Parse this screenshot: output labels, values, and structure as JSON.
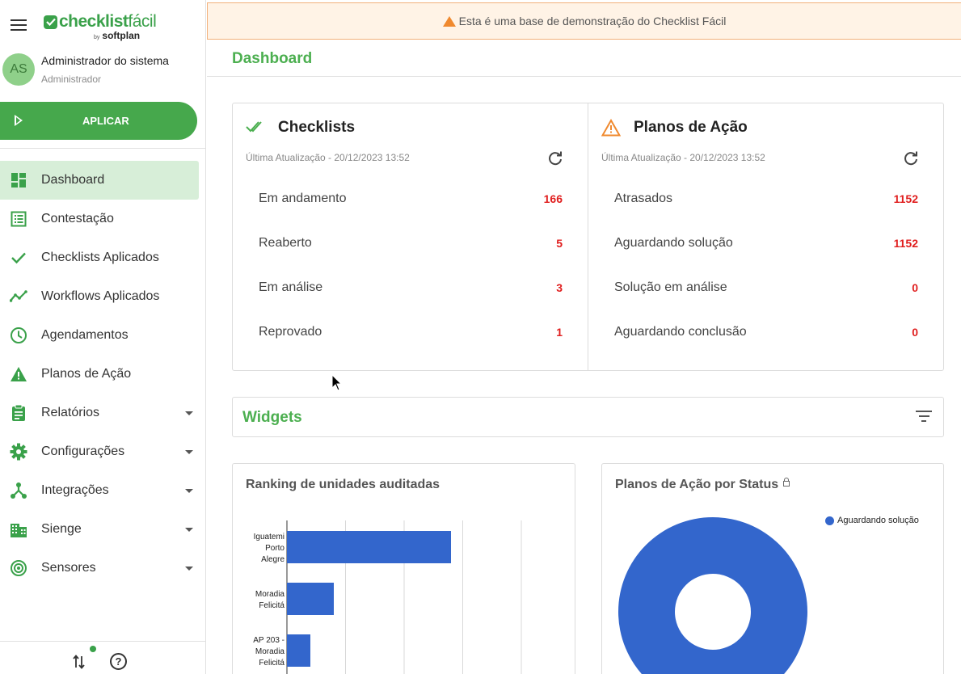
{
  "app": {
    "logo_check": "checklist",
    "logo_facil": "fácil",
    "logo_by": "by",
    "logo_company": "softplan"
  },
  "user": {
    "initials": "AS",
    "name": "Administrador do sistema",
    "role": "Administrador"
  },
  "sidebar": {
    "apply_label": "APLICAR",
    "items": [
      {
        "label": "Dashboard",
        "icon": "dashboard-icon",
        "active": true,
        "caret": false
      },
      {
        "label": "Contestação",
        "icon": "list-icon",
        "active": false,
        "caret": false
      },
      {
        "label": "Checklists Aplicados",
        "icon": "check-icon",
        "active": false,
        "caret": false
      },
      {
        "label": "Workflows Aplicados",
        "icon": "trend-icon",
        "active": false,
        "caret": false
      },
      {
        "label": "Agendamentos",
        "icon": "clock-icon",
        "active": false,
        "caret": false
      },
      {
        "label": "Planos de Ação",
        "icon": "warning-icon",
        "active": false,
        "caret": false
      },
      {
        "label": "Relatórios",
        "icon": "clipboard-icon",
        "active": false,
        "caret": true
      },
      {
        "label": "Configurações",
        "icon": "gear-icon",
        "active": false,
        "caret": true
      },
      {
        "label": "Integrações",
        "icon": "integration-icon",
        "active": false,
        "caret": true
      },
      {
        "label": "Sienge",
        "icon": "building-icon",
        "active": false,
        "caret": true
      },
      {
        "label": "Sensores",
        "icon": "sensor-icon",
        "active": false,
        "caret": true
      }
    ]
  },
  "banner": {
    "text": "Esta é uma base de demonstração do Checklist Fácil"
  },
  "page": {
    "title": "Dashboard"
  },
  "checklists": {
    "title": "Checklists",
    "updated": "Última Atualização - 20/12/2023 13:52",
    "rows": [
      {
        "label": "Em andamento",
        "value": "166"
      },
      {
        "label": "Reaberto",
        "value": "5"
      },
      {
        "label": "Em análise",
        "value": "3"
      },
      {
        "label": "Reprovado",
        "value": "1"
      }
    ]
  },
  "planos": {
    "title": "Planos de Ação",
    "updated": "Última Atualização - 20/12/2023 13:52",
    "rows": [
      {
        "label": "Atrasados",
        "value": "1152"
      },
      {
        "label": "Aguardando solução",
        "value": "1152"
      },
      {
        "label": "Solução em análise",
        "value": "0"
      },
      {
        "label": "Aguardando conclusão",
        "value": "0"
      }
    ]
  },
  "widgets": {
    "title": "Widgets"
  },
  "colors": {
    "brand_green": "#4caf50",
    "alert_red": "#e01e1e",
    "chart_blue": "#3366cc",
    "warning_orange": "#f0892e"
  },
  "charts": {
    "ranking_title": "Ranking de unidades auditadas",
    "planos_status_title": "Planos de Ação por Status"
  },
  "chart_data": [
    {
      "type": "bar",
      "orientation": "horizontal",
      "title": "Ranking de unidades auditadas",
      "categories": [
        [
          "Iguatemi",
          "Porto",
          "Alegre"
        ],
        [
          "Moradia",
          "Felicitá"
        ],
        [
          "AP 203 -",
          "Moradia",
          "Felicitá"
        ]
      ],
      "values": [
        7,
        2,
        1
      ],
      "xlim": [
        0,
        10
      ],
      "grid": true,
      "color": "#3366cc"
    },
    {
      "type": "pie",
      "donut": true,
      "title": "Planos de Ação por Status",
      "slices": [
        {
          "label": "Aguardando solução",
          "value": 1152
        }
      ],
      "legend": "top-right",
      "color": "#3366cc"
    }
  ]
}
